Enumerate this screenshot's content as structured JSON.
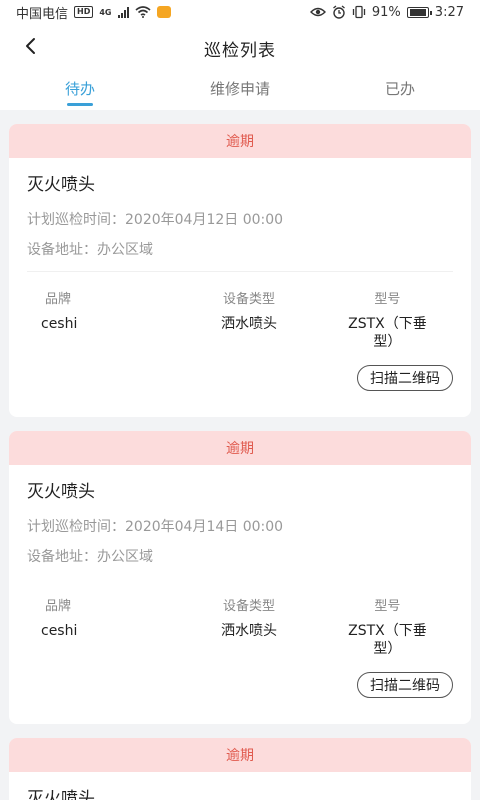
{
  "status_bar": {
    "carrier": "中国电信",
    "hd": "HD",
    "network": "4G",
    "battery": "91%",
    "time": "3:27",
    "battery_level": 0.91
  },
  "nav": {
    "title": "巡检列表"
  },
  "tabs": [
    {
      "label": "待办",
      "active": true
    },
    {
      "label": "维修申请",
      "active": false
    },
    {
      "label": "已办",
      "active": false
    }
  ],
  "colors": {
    "accent": "#3aa0d8",
    "overdue_bg": "#fcdcdc",
    "overdue_text": "#e05a4e"
  },
  "cards": [
    {
      "status": "逾期",
      "title": "灭火喷头",
      "plan_time_label": "计划巡检时间：",
      "plan_time": "2020年04月12日 00:00",
      "address_label": "设备地址：",
      "address": "办公区域",
      "brand_label": "品牌",
      "brand": "ceshi",
      "type_label": "设备类型",
      "type": "洒水喷头",
      "model_label": "型号",
      "model_line1": "ZSTX（下垂",
      "model_line2": "型）",
      "scan_label": "扫描二维码"
    },
    {
      "status": "逾期",
      "title": "灭火喷头",
      "plan_time_label": "计划巡检时间：",
      "plan_time": "2020年04月14日 00:00",
      "address_label": "设备地址：",
      "address": "办公区域",
      "brand_label": "品牌",
      "brand": "ceshi",
      "type_label": "设备类型",
      "type": "洒水喷头",
      "model_label": "型号",
      "model_line1": "ZSTX（下垂",
      "model_line2": "型）",
      "scan_label": "扫描二维码"
    },
    {
      "status": "逾期",
      "title": "灭火喷头"
    }
  ]
}
